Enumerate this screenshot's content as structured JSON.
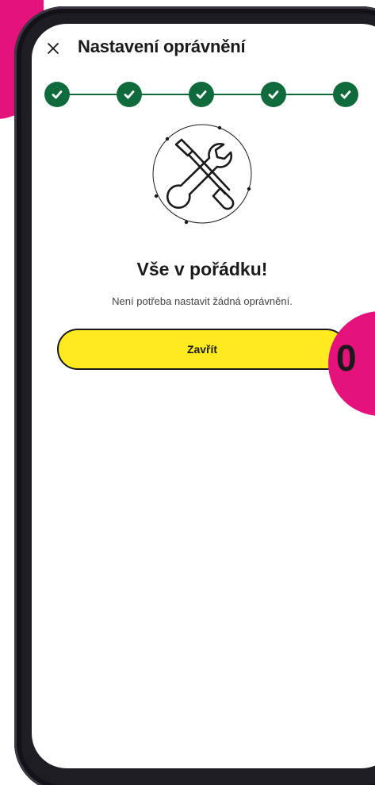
{
  "header": {
    "title": "Nastavení oprávnění",
    "close_icon": "close-icon"
  },
  "stepper": {
    "total_steps": 5,
    "completed_steps": 5,
    "step_icon": "check-icon",
    "accent_color": "#0f6b3c"
  },
  "illustration": {
    "icon": "wrench-screwdriver-icon"
  },
  "result": {
    "heading": "Vše v pořádku!",
    "message": "Není potřeba nastavit žádná oprávnění."
  },
  "actions": {
    "close_label": "Zavřít",
    "button_color": "#ffeb1f"
  },
  "decor": {
    "badge_text": "0",
    "brand_color": "#e5127b"
  }
}
